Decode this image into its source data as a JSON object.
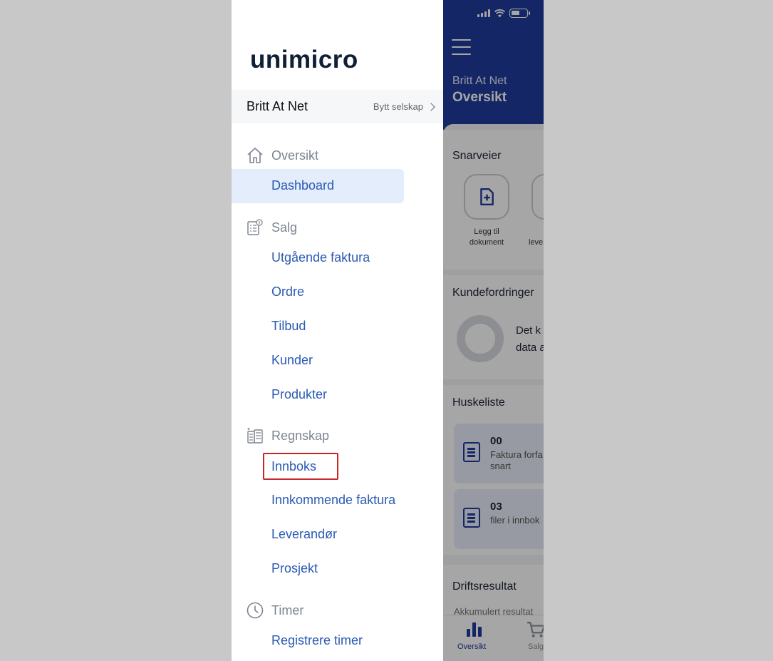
{
  "menu": {
    "logo": "unimicro",
    "company": "Britt At Net",
    "switch_company": "Bytt selskap",
    "groups": [
      {
        "label": "Oversikt",
        "icon": "home-icon",
        "items": [
          "Dashboard"
        ]
      },
      {
        "label": "Salg",
        "icon": "sales-icon",
        "items": [
          "Utgående faktura",
          "Ordre",
          "Tilbud",
          "Kunder",
          "Produkter"
        ]
      },
      {
        "label": "Regnskap",
        "icon": "accounting-icon",
        "items": [
          "Innboks",
          "Innkommende faktura",
          "Leverandør",
          "Prosjekt"
        ]
      },
      {
        "label": "Timer",
        "icon": "clock-icon",
        "items": [
          "Registrere timer"
        ]
      }
    ],
    "active_item": "Dashboard",
    "highlighted_item": "Innboks"
  },
  "app": {
    "company": "Britt At Net",
    "title": "Oversikt",
    "shortcuts_title": "Snarveier",
    "shortcut_1": {
      "line1": "Legg til",
      "line2": "dokument"
    },
    "shortcut_2_partial": "leve",
    "receivables_title": "Kundefordringer",
    "receivables_text_1": "Det k",
    "receivables_text_2": "data a",
    "todo_title": "Huskeliste",
    "todo_1": {
      "count": "00",
      "line1": "Faktura forfa",
      "line2": "snart"
    },
    "todo_2": {
      "count": "03",
      "line1": "filer i innbok"
    },
    "result_title": "Driftsresultat",
    "result_sub": "Akkumulert resultat",
    "tabs": [
      "Oversikt",
      "Salg"
    ]
  },
  "colors": {
    "brand_blue": "#1f3b9c",
    "link_blue": "#2a5ab3",
    "highlight_red": "#c8282c"
  }
}
